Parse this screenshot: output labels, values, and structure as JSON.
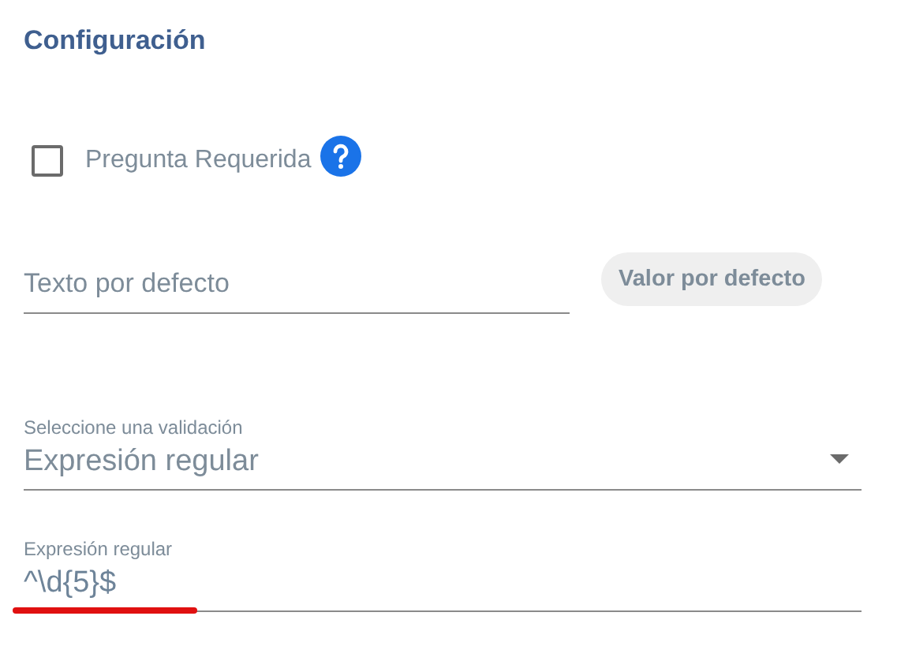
{
  "title": "Configuración",
  "required_checkbox": {
    "label": "Pregunta Requerida",
    "checked": false
  },
  "default_text": {
    "placeholder": "Texto por defecto"
  },
  "default_button": "Valor por defecto",
  "validation_select": {
    "label": "Seleccione una validación",
    "value": "Expresión regular"
  },
  "regex_field": {
    "label": "Expresión regular",
    "value": "^\\d{5}$"
  }
}
